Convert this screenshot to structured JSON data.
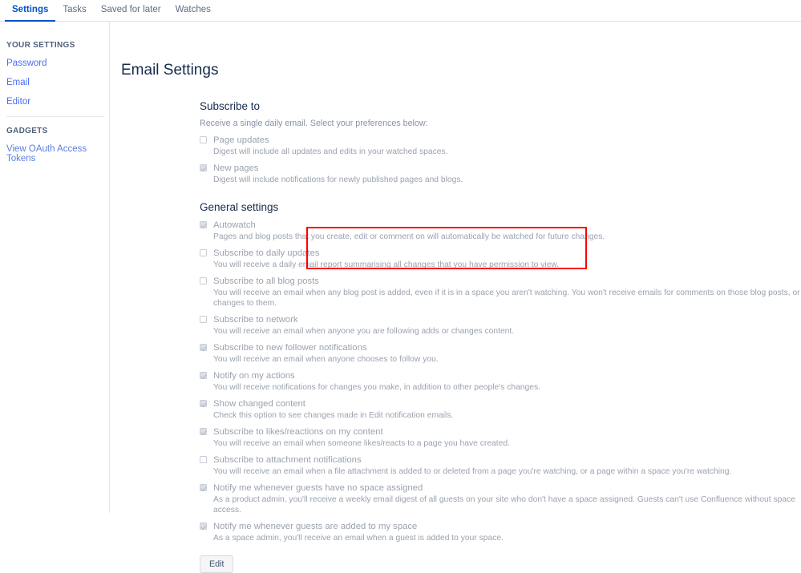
{
  "tabs": [
    {
      "label": "Settings",
      "active": true
    },
    {
      "label": "Tasks",
      "active": false
    },
    {
      "label": "Saved for later",
      "active": false
    },
    {
      "label": "Watches",
      "active": false
    }
  ],
  "sidebar": {
    "your_settings_heading": "YOUR SETTINGS",
    "your_settings_items": [
      {
        "label": "Password"
      },
      {
        "label": "Email"
      },
      {
        "label": "Editor"
      }
    ],
    "gadgets_heading": "GADGETS",
    "gadgets_items": [
      {
        "label": "View OAuth Access Tokens"
      }
    ]
  },
  "main": {
    "page_title": "Email Settings",
    "subscribe_section": {
      "title": "Subscribe to",
      "lead": "Receive a single daily email. Select your preferences below:",
      "options": [
        {
          "label": "Page updates",
          "checked": false,
          "description": "Digest will include all updates and edits in your watched spaces."
        },
        {
          "label": "New pages",
          "checked": true,
          "description": "Digest will include notifications for newly published pages and blogs."
        }
      ]
    },
    "general_section": {
      "title": "General settings",
      "options": [
        {
          "label": "Autowatch",
          "checked": true,
          "description": "Pages and blog posts that you create, edit or comment on will automatically be watched for future changes."
        },
        {
          "label": "Subscribe to daily updates",
          "checked": false,
          "description": "You will receive a daily email report summarising all changes that you have permission to view."
        },
        {
          "label": "Subscribe to all blog posts",
          "checked": false,
          "description": "You will receive an email when any blog post is added, even if it is in a space you aren't watching. You won't receive emails for comments on those blog posts, or changes to them."
        },
        {
          "label": "Subscribe to network",
          "checked": false,
          "description": "You will receive an email when anyone you are following adds or changes content."
        },
        {
          "label": "Subscribe to new follower notifications",
          "checked": true,
          "description": "You will receive an email when anyone chooses to follow you."
        },
        {
          "label": "Notify on my actions",
          "checked": true,
          "description": "You will receive notifications for changes you make, in addition to other people's changes."
        },
        {
          "label": "Show changed content",
          "checked": true,
          "description": "Check this option to see changes made in Edit notification emails."
        },
        {
          "label": "Subscribe to likes/reactions on my content",
          "checked": true,
          "description": "You will receive an email when someone likes/reacts to a page you have created."
        },
        {
          "label": "Subscribe to attachment notifications",
          "checked": false,
          "description": "You will receive an email when a file attachment is added to or deleted from a page you're watching, or a page within a space you're watching."
        },
        {
          "label": "Notify me whenever guests have no space assigned",
          "checked": true,
          "description": "As a product admin, you'll receive a weekly email digest of all guests on your site who don't have a space assigned. Guests can't use Confluence without space access."
        },
        {
          "label": "Notify me whenever guests are added to my space",
          "checked": true,
          "description": "As a space admin, you'll receive an email when a guest is added to your space."
        }
      ]
    },
    "edit_button_label": "Edit"
  },
  "annotation": {
    "color": "#ff0000",
    "target_label": "New pages"
  }
}
